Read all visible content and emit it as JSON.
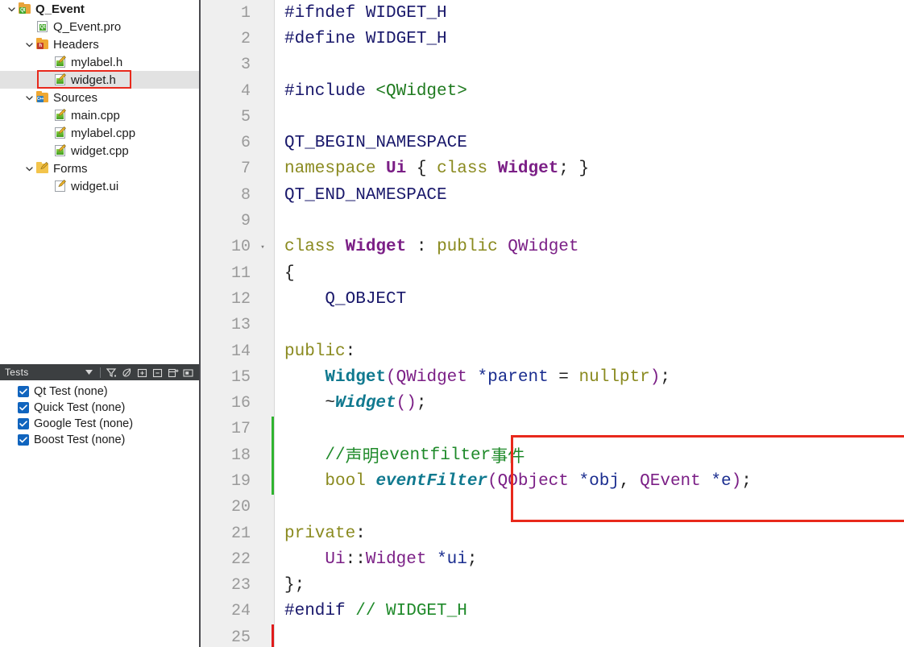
{
  "window": {
    "app": "Qt Creator",
    "open_file": "widget.h"
  },
  "project_tree": {
    "items": [
      {
        "label": "Q_Event",
        "indent": 0,
        "twisty": "expanded",
        "icon": "folder-qt-icon",
        "bold": true,
        "selected": false
      },
      {
        "label": "Q_Event.pro",
        "indent": 1,
        "twisty": "none",
        "icon": "file-qt-pro-icon",
        "bold": false,
        "selected": false
      },
      {
        "label": "Headers",
        "indent": 1,
        "twisty": "expanded",
        "icon": "folder-headers-icon",
        "bold": false,
        "selected": false
      },
      {
        "label": "mylabel.h",
        "indent": 2,
        "twisty": "none",
        "icon": "file-cpp-icon",
        "bold": false,
        "selected": false
      },
      {
        "label": "widget.h",
        "indent": 2,
        "twisty": "none",
        "icon": "file-cpp-icon",
        "bold": false,
        "selected": true
      },
      {
        "label": "Sources",
        "indent": 1,
        "twisty": "expanded",
        "icon": "folder-sources-icon",
        "bold": false,
        "selected": false
      },
      {
        "label": "main.cpp",
        "indent": 2,
        "twisty": "none",
        "icon": "file-cpp-icon",
        "bold": false,
        "selected": false
      },
      {
        "label": "mylabel.cpp",
        "indent": 2,
        "twisty": "none",
        "icon": "file-cpp-icon",
        "bold": false,
        "selected": false
      },
      {
        "label": "widget.cpp",
        "indent": 2,
        "twisty": "none",
        "icon": "file-cpp-icon",
        "bold": false,
        "selected": false
      },
      {
        "label": "Forms",
        "indent": 1,
        "twisty": "expanded",
        "icon": "folder-forms-icon",
        "bold": false,
        "selected": false
      },
      {
        "label": "widget.ui",
        "indent": 2,
        "twisty": "none",
        "icon": "file-ui-icon",
        "bold": false,
        "selected": false
      }
    ]
  },
  "tests_panel": {
    "title": "Tests",
    "toolbar": [
      {
        "name": "dropdown-arrow-icon",
        "glyph": "chevron-down"
      },
      {
        "name": "filter-icon",
        "glyph": "filter"
      },
      {
        "name": "leaf-icon",
        "glyph": "leaf"
      },
      {
        "name": "expand-all-icon",
        "glyph": "plus-box"
      },
      {
        "name": "collapse-all-icon",
        "glyph": "minus-box"
      },
      {
        "name": "add-frame-icon",
        "glyph": "frame-plus"
      },
      {
        "name": "options-icon",
        "glyph": "box-inner"
      }
    ],
    "items": [
      {
        "label": "Qt Test (none)",
        "checked": true
      },
      {
        "label": "Quick Test (none)",
        "checked": true
      },
      {
        "label": "Google Test (none)",
        "checked": true
      },
      {
        "label": "Boost Test (none)",
        "checked": true
      }
    ]
  },
  "editor": {
    "lines": [
      {
        "n": "1",
        "fold": "",
        "change": "",
        "tokens": [
          {
            "t": "#ifndef ",
            "c": "t-pre"
          },
          {
            "t": "WIDGET_H",
            "c": "t-pre"
          }
        ]
      },
      {
        "n": "2",
        "fold": "",
        "change": "",
        "tokens": [
          {
            "t": "#define ",
            "c": "t-pre"
          },
          {
            "t": "WIDGET_H",
            "c": "t-pre"
          }
        ]
      },
      {
        "n": "3",
        "fold": "",
        "change": "",
        "tokens": []
      },
      {
        "n": "4",
        "fold": "",
        "change": "",
        "tokens": [
          {
            "t": "#include ",
            "c": "t-pre"
          },
          {
            "t": "<QWidget>",
            "c": "t-str"
          }
        ]
      },
      {
        "n": "5",
        "fold": "",
        "change": "",
        "tokens": []
      },
      {
        "n": "6",
        "fold": "",
        "change": "",
        "tokens": [
          {
            "t": "QT_BEGIN_NAMESPACE",
            "c": "t-macro"
          }
        ]
      },
      {
        "n": "7",
        "fold": "",
        "change": "",
        "tokens": [
          {
            "t": "namespace ",
            "c": "t-kw"
          },
          {
            "t": "Ui",
            "c": "t-type"
          },
          {
            "t": " { ",
            "c": "t-plain"
          },
          {
            "t": "class ",
            "c": "t-kw"
          },
          {
            "t": "Widget",
            "c": "t-type"
          },
          {
            "t": "; }",
            "c": "t-plain"
          }
        ]
      },
      {
        "n": "8",
        "fold": "",
        "change": "",
        "tokens": [
          {
            "t": "QT_END_NAMESPACE",
            "c": "t-macro"
          }
        ]
      },
      {
        "n": "9",
        "fold": "",
        "change": "",
        "tokens": []
      },
      {
        "n": "10",
        "fold": "▾",
        "change": "",
        "tokens": [
          {
            "t": "class ",
            "c": "t-kw"
          },
          {
            "t": "Widget",
            "c": "t-type"
          },
          {
            "t": " : ",
            "c": "t-plain"
          },
          {
            "t": "public ",
            "c": "t-kw"
          },
          {
            "t": "QWidget",
            "c": "t-cls"
          }
        ]
      },
      {
        "n": "11",
        "fold": "",
        "change": "",
        "tokens": [
          {
            "t": "{",
            "c": "t-plain"
          }
        ]
      },
      {
        "n": "12",
        "fold": "",
        "change": "",
        "tokens": [
          {
            "t": "    ",
            "c": "t-plain"
          },
          {
            "t": "Q_OBJECT",
            "c": "t-macro"
          }
        ]
      },
      {
        "n": "13",
        "fold": "",
        "change": "",
        "tokens": []
      },
      {
        "n": "14",
        "fold": "",
        "change": "",
        "tokens": [
          {
            "t": "public",
            "c": "t-kw"
          },
          {
            "t": ":",
            "c": "t-plain"
          }
        ]
      },
      {
        "n": "15",
        "fold": "",
        "change": "",
        "tokens": [
          {
            "t": "    ",
            "c": "t-plain"
          },
          {
            "t": "Widget",
            "c": "t-ctor"
          },
          {
            "t": "(",
            "c": "t-cls"
          },
          {
            "t": "QWidget ",
            "c": "t-cls"
          },
          {
            "t": "*parent",
            "c": "t-var"
          },
          {
            "t": " = ",
            "c": "t-plain"
          },
          {
            "t": "nullptr",
            "c": "t-num"
          },
          {
            "t": ")",
            "c": "t-cls"
          },
          {
            "t": ";",
            "c": "t-plain"
          }
        ]
      },
      {
        "n": "16",
        "fold": "",
        "change": "",
        "tokens": [
          {
            "t": "    ~",
            "c": "t-plain"
          },
          {
            "t": "Widget",
            "c": "t-dtor"
          },
          {
            "t": "()",
            "c": "t-cls"
          },
          {
            "t": ";",
            "c": "t-plain"
          }
        ]
      },
      {
        "n": "17",
        "fold": "",
        "change": "green",
        "tokens": []
      },
      {
        "n": "18",
        "fold": "",
        "change": "green",
        "tokens": [
          {
            "t": "    ",
            "c": "t-plain"
          },
          {
            "t": "//",
            "c": "t-cmt"
          },
          {
            "t": "声明",
            "c": "t-cjk"
          },
          {
            "t": "eventfilter",
            "c": "t-cmt"
          },
          {
            "t": "事件",
            "c": "t-cjk"
          }
        ]
      },
      {
        "n": "19",
        "fold": "",
        "change": "green",
        "tokens": [
          {
            "t": "    ",
            "c": "t-plain"
          },
          {
            "t": "bool ",
            "c": "t-kw"
          },
          {
            "t": "eventFilter",
            "c": "t-fn"
          },
          {
            "t": "(",
            "c": "t-cls"
          },
          {
            "t": "QObject ",
            "c": "t-cls"
          },
          {
            "t": "*obj",
            "c": "t-var"
          },
          {
            "t": ", ",
            "c": "t-plain"
          },
          {
            "t": "QEvent ",
            "c": "t-cls"
          },
          {
            "t": "*e",
            "c": "t-var"
          },
          {
            "t": ")",
            "c": "t-cls"
          },
          {
            "t": ";",
            "c": "t-plain"
          }
        ]
      },
      {
        "n": "20",
        "fold": "",
        "change": "",
        "tokens": []
      },
      {
        "n": "21",
        "fold": "",
        "change": "",
        "tokens": [
          {
            "t": "private",
            "c": "t-kw"
          },
          {
            "t": ":",
            "c": "t-plain"
          }
        ]
      },
      {
        "n": "22",
        "fold": "",
        "change": "",
        "tokens": [
          {
            "t": "    ",
            "c": "t-plain"
          },
          {
            "t": "Ui",
            "c": "t-cls"
          },
          {
            "t": "::",
            "c": "t-plain"
          },
          {
            "t": "Widget ",
            "c": "t-cls"
          },
          {
            "t": "*ui",
            "c": "t-var"
          },
          {
            "t": ";",
            "c": "t-plain"
          }
        ]
      },
      {
        "n": "23",
        "fold": "",
        "change": "",
        "tokens": [
          {
            "t": "};",
            "c": "t-plain"
          }
        ]
      },
      {
        "n": "24",
        "fold": "",
        "change": "",
        "tokens": [
          {
            "t": "#endif ",
            "c": "t-pre"
          },
          {
            "t": "// WIDGET_H",
            "c": "t-cmt"
          }
        ]
      },
      {
        "n": "25",
        "fold": "",
        "change": "red",
        "tokens": []
      }
    ]
  },
  "annotations": {
    "file_highlight": {
      "name": "widget.h",
      "color": "#e8291c"
    },
    "code_highlight": {
      "description": "eventFilter declaration",
      "color": "#e8291c"
    }
  }
}
